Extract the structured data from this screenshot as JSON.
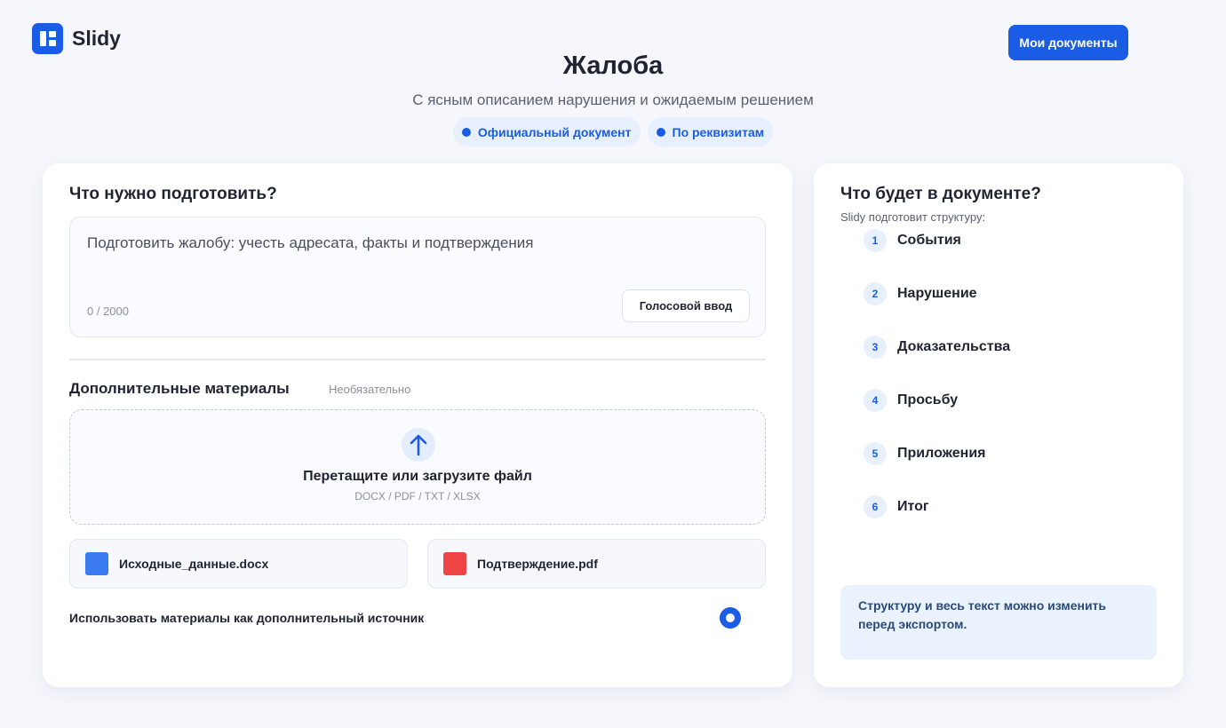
{
  "header": {
    "logo_text": "Slidy",
    "my_docs_label": "Мои документы"
  },
  "hero": {
    "title": "Жалоба",
    "subtitle": "С ясным описанием нарушения и ожидаемым решением",
    "tags": [
      "Официальный документ",
      "По реквизитам"
    ]
  },
  "form": {
    "section_title": "Что нужно подготовить?",
    "prompt_value": "Подготовить жалобу: учесть адресата, факты и подтверждения",
    "counter": "0 / 2000",
    "voice_label": "Голосовой ввод",
    "materials_title": "Дополнительные материалы",
    "optional_label": "Необязательно",
    "dropzone": {
      "title": "Перетащите или загрузите файл",
      "formats": "DOCX / PDF / TXT / XLSX"
    },
    "files": [
      {
        "name": "Исходные_данные.docx",
        "color": "#3b7bf0"
      },
      {
        "name": "Подтверждение.pdf",
        "color": "#ef4444"
      }
    ],
    "use_materials_label": "Использовать материалы как дополнительный источник",
    "use_materials_enabled": true
  },
  "structure": {
    "title": "Что будет в документе?",
    "subtitle": "Slidy подготовит структуру:",
    "steps": [
      {
        "num": "1",
        "label": "События"
      },
      {
        "num": "2",
        "label": "Нарушение"
      },
      {
        "num": "3",
        "label": "Доказательства"
      },
      {
        "num": "4",
        "label": "Просьбу"
      },
      {
        "num": "5",
        "label": "Приложения"
      },
      {
        "num": "6",
        "label": "Итог"
      }
    ],
    "note": "Структуру и весь текст можно изменить перед экспортом."
  },
  "colors": {
    "accent": "#1a5ce6",
    "background": "#f5f7fc"
  }
}
